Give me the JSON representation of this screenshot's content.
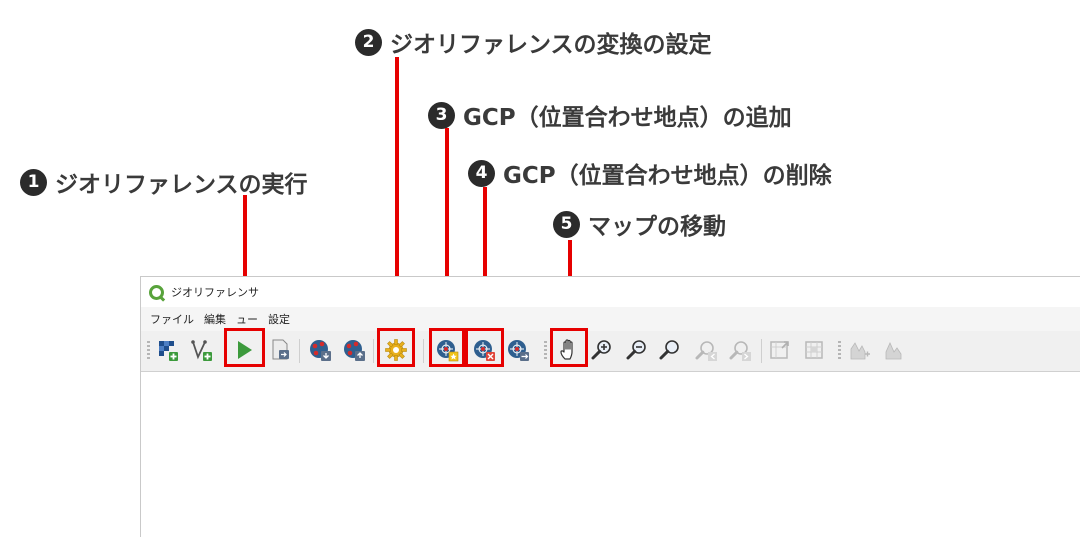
{
  "callouts": [
    {
      "num": "1",
      "text": "ジオリファレンスの実行"
    },
    {
      "num": "2",
      "text": "ジオリファレンスの変換の設定"
    },
    {
      "num": "3",
      "text": "GCP（位置合わせ地点）の追加"
    },
    {
      "num": "4",
      "text": "GCP（位置合わせ地点）の削除"
    },
    {
      "num": "5",
      "text": "マップの移動"
    }
  ],
  "window": {
    "title": "ジオリファレンサ",
    "menu": [
      "ファイル",
      "編集",
      "ュー",
      "設定"
    ]
  },
  "toolbar_icons": [
    "open-raster-icon",
    "open-vector-icon",
    "start-georeferencing-icon",
    "generate-gdal-script-icon",
    "load-gcp-icon",
    "save-gcp-icon",
    "transformation-settings-icon",
    "add-point-icon",
    "delete-point-icon",
    "move-gcp-icon",
    "pan-icon",
    "zoom-in-icon",
    "zoom-out-icon",
    "zoom-layer-icon",
    "zoom-last-icon",
    "zoom-next-icon",
    "link-georef-icon",
    "link-qgis-icon",
    "histogram-icon",
    "local-histogram-icon"
  ],
  "colors": {
    "highlight": "#e60000",
    "accent_green": "#58a33b"
  }
}
